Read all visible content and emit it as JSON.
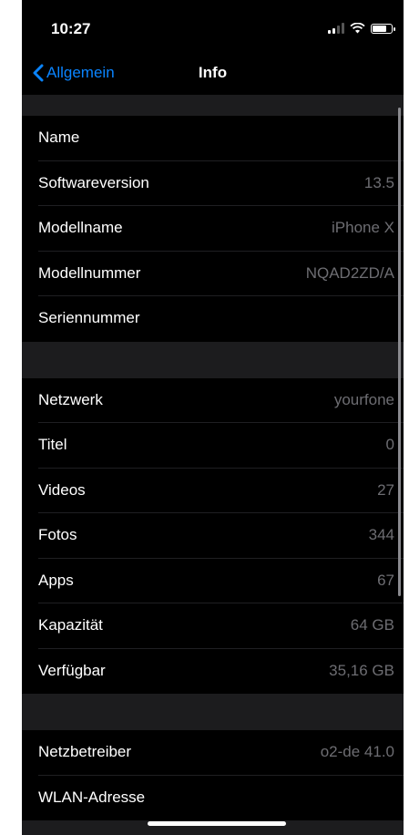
{
  "status_bar": {
    "time": "10:27"
  },
  "nav": {
    "back_label": "Allgemein",
    "title": "Info"
  },
  "sections": [
    {
      "rows": [
        {
          "label": "Name",
          "value": ""
        },
        {
          "label": "Softwareversion",
          "value": "13.5"
        },
        {
          "label": "Modellname",
          "value": "iPhone X"
        },
        {
          "label": "Modellnummer",
          "value": "NQAD2ZD/A"
        },
        {
          "label": "Seriennummer",
          "value": ""
        }
      ]
    },
    {
      "rows": [
        {
          "label": "Netzwerk",
          "value": "yourfone"
        },
        {
          "label": "Titel",
          "value": "0"
        },
        {
          "label": "Videos",
          "value": "27"
        },
        {
          "label": "Fotos",
          "value": "344"
        },
        {
          "label": "Apps",
          "value": "67"
        },
        {
          "label": "Kapazität",
          "value": "64 GB"
        },
        {
          "label": "Verfügbar",
          "value": "35,16 GB"
        }
      ]
    },
    {
      "rows": [
        {
          "label": "Netzbetreiber",
          "value": "o2-de 41.0"
        },
        {
          "label": "WLAN-Adresse",
          "value": ""
        }
      ]
    }
  ],
  "icons": {
    "back": "chevron-left-icon",
    "signal": "cellular-signal-icon",
    "wifi": "wifi-icon",
    "battery": "battery-icon"
  },
  "colors": {
    "accent": "#0a84ff",
    "background": "#000000",
    "separator_area": "#1c1c1e",
    "secondary_text": "#6d6d72"
  }
}
